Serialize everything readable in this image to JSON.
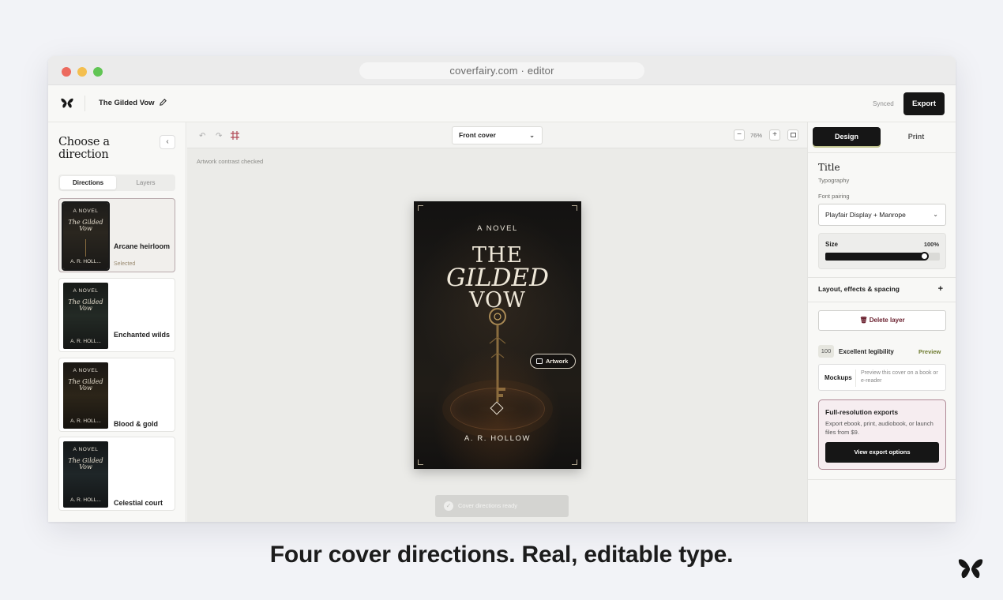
{
  "browser": {
    "url_text": "coverfairy.com · editor"
  },
  "appbar": {
    "document_title": "The Gilded Vow",
    "sync_status": "Synced",
    "export_label": "Export"
  },
  "left_panel": {
    "heading": "Choose a direction",
    "collapse_icon": "chevron-left-icon",
    "tabs": [
      "Directions",
      "Layers"
    ],
    "directions": [
      {
        "name": "Arcane heirloom",
        "status": "Selected",
        "thumb_kicker": "A NOVEL",
        "thumb_title": "The Gilded Vow",
        "thumb_author": "A. R. HOLL..."
      },
      {
        "name": "Enchanted wilds",
        "status": "",
        "thumb_kicker": "A NOVEL",
        "thumb_title": "The Gilded Vow",
        "thumb_author": "A. R. HOLL..."
      },
      {
        "name": "Blood & gold",
        "status": "",
        "thumb_kicker": "A NOVEL",
        "thumb_title": "The Gilded Vow",
        "thumb_author": "A. R. HOLL..."
      },
      {
        "name": "Celestial court",
        "status": "",
        "thumb_kicker": "A NOVEL",
        "thumb_title": "The Gilded Vow",
        "thumb_author": "A. R. HOLL..."
      }
    ]
  },
  "canvas": {
    "undo_icon": "undo-icon",
    "redo_icon": "redo-icon",
    "crop_icon": "frame-icon",
    "view_select": "Front cover",
    "zoom_level": "76%",
    "status_note": "Artwork contrast checked",
    "cover": {
      "kicker": "A NOVEL",
      "title_line1": "THE",
      "title_line2": "GILDED",
      "title_line3": "VOW",
      "author": "A. R. HOLLOW",
      "artwork_button": "Artwork"
    },
    "toast": "Cover directions ready"
  },
  "right_panel": {
    "tabs": [
      "Design",
      "Print"
    ],
    "active_tab": "Design",
    "section_title": "Title",
    "section_subtitle": "Typography",
    "font_pairing_label": "Font pairing",
    "font_pairing_value": "Playfair Display + Manrope",
    "size_label": "Size",
    "size_value_text": "100%",
    "size_value": 0.86,
    "layout_row": "Layout, effects & spacing",
    "layout_expand": "+",
    "delete_label": "Delete layer",
    "legibility_score": "100",
    "legibility_label": "Excellent legibility",
    "preview_link": "Preview",
    "mockups_label": "Mockups",
    "mockups_desc": "Preview this cover on a book or e-reader",
    "promo_title": "Full-resolution exports",
    "promo_desc": "Export ebook, print, audiobook, or launch files from $9.",
    "promo_button": "View export options"
  },
  "tagline": "Four cover directions. Real, editable type.",
  "colors": {
    "accent_dark": "#161616",
    "preview_green": "#6e7a2f",
    "danger": "#6b2230",
    "promo_border": "#b08a96"
  }
}
